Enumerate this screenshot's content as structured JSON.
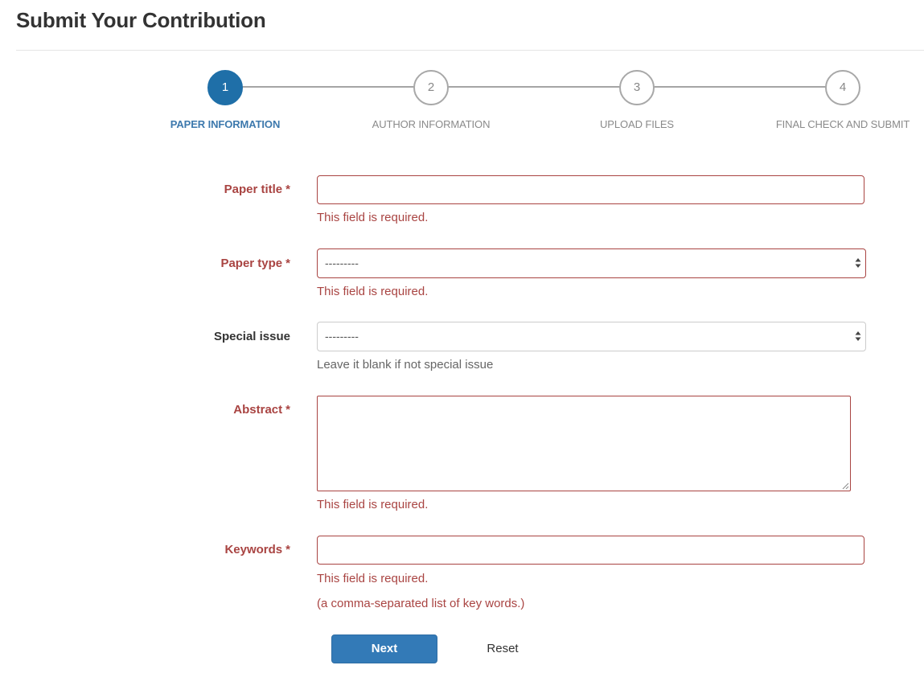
{
  "page": {
    "title": "Submit Your Contribution"
  },
  "stepper": {
    "current_step": 1,
    "steps": [
      {
        "number": "1",
        "label": "PAPER INFORMATION"
      },
      {
        "number": "2",
        "label": "AUTHOR INFORMATION"
      },
      {
        "number": "3",
        "label": "UPLOAD FILES"
      },
      {
        "number": "4",
        "label": "FINAL CHECK AND SUBMIT"
      }
    ]
  },
  "form": {
    "paper_title": {
      "label": "Paper title",
      "required_mark": "*",
      "value": "",
      "error": "This field is required."
    },
    "paper_type": {
      "label": "Paper type",
      "required_mark": "*",
      "selected": "---------",
      "error": "This field is required."
    },
    "special_issue": {
      "label": "Special issue",
      "selected": "---------",
      "help": "Leave it blank if not special issue"
    },
    "abstract": {
      "label": "Abstract",
      "required_mark": "*",
      "value": "",
      "error": "This field is required."
    },
    "keywords": {
      "label": "Keywords",
      "required_mark": "*",
      "value": "",
      "error": "This field is required.",
      "help": "(a comma-separated list of key words.)"
    }
  },
  "actions": {
    "next_label": "Next",
    "reset_label": "Reset"
  },
  "colors": {
    "accent": "#337ab7",
    "step_active": "#1f6fa8",
    "error": "#a94442",
    "muted": "#8a8a8a"
  }
}
